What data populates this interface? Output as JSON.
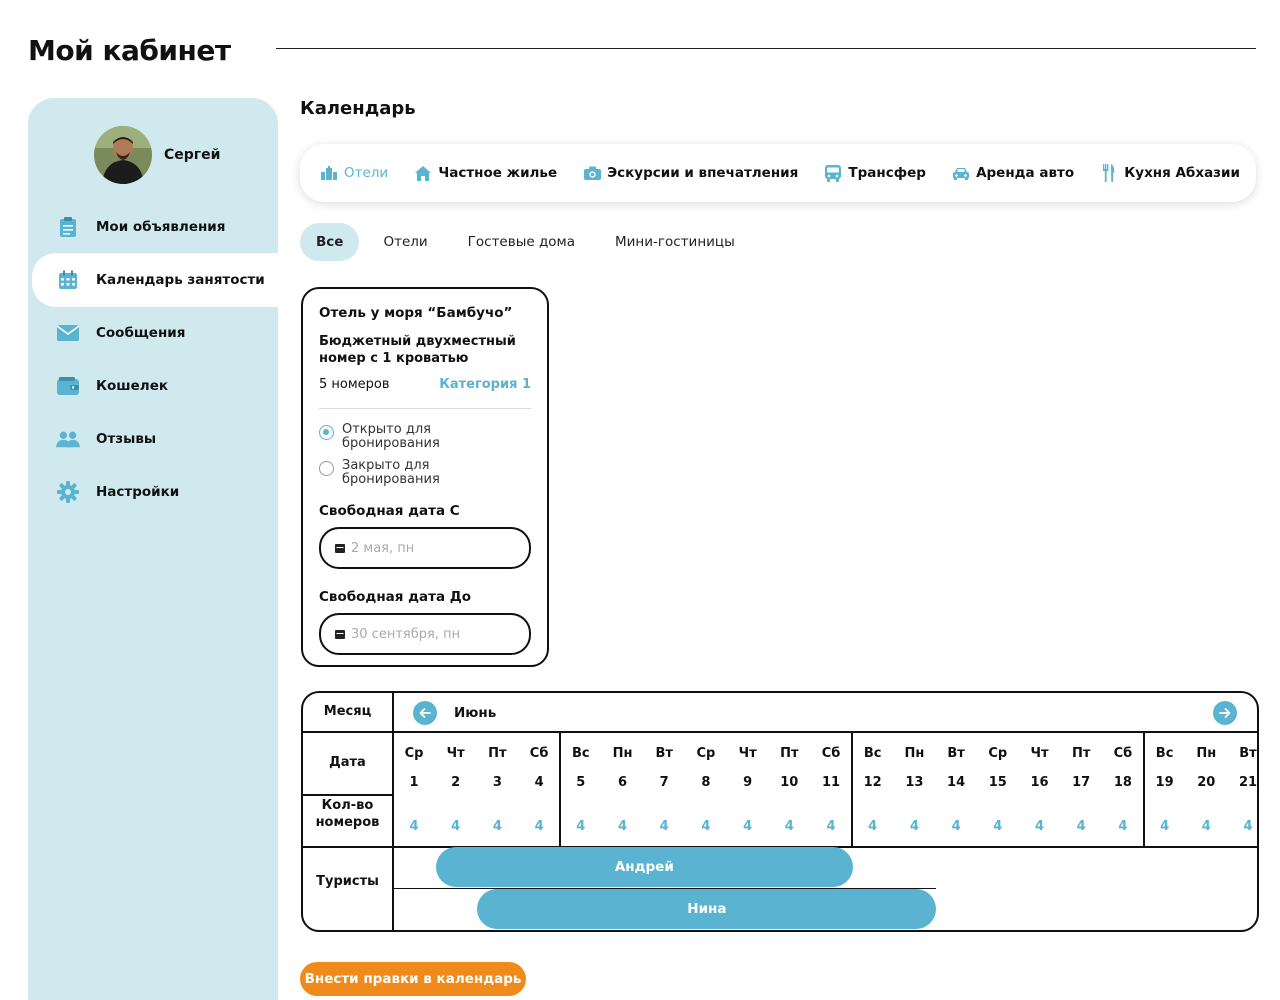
{
  "page": {
    "title": "Мой кабинет"
  },
  "profile": {
    "name": "Сергей"
  },
  "sidebar": {
    "items": [
      {
        "label": "Мои объявления",
        "icon": "clipboard-icon"
      },
      {
        "label": "Календарь занятости",
        "icon": "calendar-icon",
        "active": true
      },
      {
        "label": "Сообщения",
        "icon": "envelope-icon"
      },
      {
        "label": "Кошелек",
        "icon": "wallet-icon"
      },
      {
        "label": "Отзывы",
        "icon": "users-icon"
      },
      {
        "label": "Настройки",
        "icon": "gear-icon"
      }
    ]
  },
  "section": {
    "title": "Календарь"
  },
  "categories": [
    {
      "label": "Отели",
      "icon": "building-icon",
      "active": true
    },
    {
      "label": "Частное жилье",
      "icon": "house-icon"
    },
    {
      "label": "Эскурсии и впечатления",
      "icon": "camera-icon"
    },
    {
      "label": "Трансфер",
      "icon": "bus-icon"
    },
    {
      "label": "Аренда авто",
      "icon": "car-icon"
    },
    {
      "label": "Кухня Абхазии",
      "icon": "cutlery-icon"
    }
  ],
  "subtabs": [
    {
      "label": "Все",
      "active": true
    },
    {
      "label": "Отели"
    },
    {
      "label": "Гостевые дома"
    },
    {
      "label": "Мини-гостиницы"
    }
  ],
  "card": {
    "hotel": "Отель у моря “Бамбучо”",
    "room": "Бюджетный двухместный номер с 1 кроватью",
    "rooms_count": "5 номеров",
    "category_link": "Категория 1",
    "radio_open": "Открыто для бронирования",
    "radio_closed": "Закрыто для бронирования",
    "selected_status": "open",
    "date_from_label": "Свободная дата С",
    "date_from_placeholder": "2 мая, пн",
    "date_to_label": "Свободная дата До",
    "date_to_placeholder": "30 сентября, пн"
  },
  "calendar": {
    "month_label": "Месяц",
    "month": "Июнь",
    "date_label": "Дата",
    "count_label": "Кол-во номеров",
    "tourists_label": "Туристы",
    "days": [
      {
        "wd": "Ср",
        "d": "1",
        "n": "4"
      },
      {
        "wd": "Чт",
        "d": "2",
        "n": "4"
      },
      {
        "wd": "Пт",
        "d": "3",
        "n": "4"
      },
      {
        "wd": "Сб",
        "d": "4",
        "n": "4"
      },
      {
        "wd": "Вс",
        "d": "5",
        "n": "4"
      },
      {
        "wd": "Пн",
        "d": "6",
        "n": "4"
      },
      {
        "wd": "Вт",
        "d": "7",
        "n": "4"
      },
      {
        "wd": "Ср",
        "d": "8",
        "n": "4"
      },
      {
        "wd": "Чт",
        "d": "9",
        "n": "4"
      },
      {
        "wd": "Пт",
        "d": "10",
        "n": "4"
      },
      {
        "wd": "Сб",
        "d": "11",
        "n": "4"
      },
      {
        "wd": "Вс",
        "d": "12",
        "n": "4"
      },
      {
        "wd": "Пн",
        "d": "13",
        "n": "4"
      },
      {
        "wd": "Вт",
        "d": "14",
        "n": "4"
      },
      {
        "wd": "Ср",
        "d": "15",
        "n": "4"
      },
      {
        "wd": "Чт",
        "d": "16",
        "n": "4"
      },
      {
        "wd": "Пт",
        "d": "17",
        "n": "4"
      },
      {
        "wd": "Сб",
        "d": "18",
        "n": "4"
      },
      {
        "wd": "Вс",
        "d": "19",
        "n": "4"
      },
      {
        "wd": "Пн",
        "d": "20",
        "n": "4"
      },
      {
        "wd": "Вт",
        "d": "21",
        "n": "4"
      }
    ],
    "bookings": [
      {
        "name": "Андрей",
        "from_day": 2,
        "to_day": 11
      },
      {
        "name": "Нина",
        "from_day": 3,
        "to_day": 13
      }
    ]
  },
  "actions": {
    "edit_calendar": "Внести правки в календарь"
  },
  "colors": {
    "accent": "#5ab4d1",
    "sidebar": "#cfe9ef",
    "button": "#ef8a1b"
  }
}
